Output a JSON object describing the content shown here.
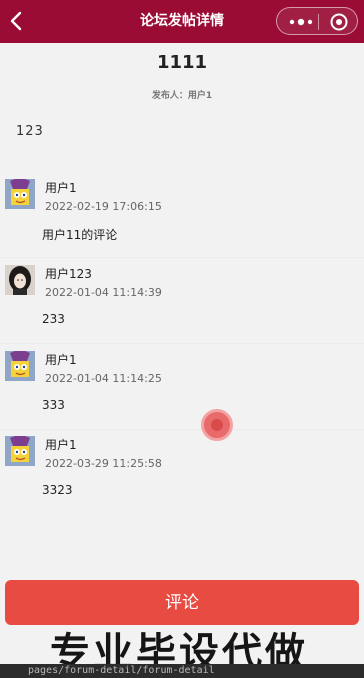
{
  "header": {
    "title": "论坛发帖详情",
    "back_icon": "chevron-left-icon",
    "more_icon": "more-dots-icon",
    "close_icon": "target-circle-icon"
  },
  "post": {
    "title": "1111",
    "author_line": "发布人：用户1",
    "content": "123"
  },
  "comments": [
    {
      "user": "用户1",
      "time": "2022-02-19 17:06:15",
      "text": "用户11的评论",
      "avatar": "sponge-avatar"
    },
    {
      "user": "用户123",
      "time": "2022-01-04 11:14:39",
      "text": "233",
      "avatar": "girl-avatar"
    },
    {
      "user": "用户1",
      "time": "2022-01-04 11:14:25",
      "text": "333",
      "avatar": "sponge-avatar"
    },
    {
      "user": "用户1",
      "time": "2022-03-29 11:25:58",
      "text": "3323",
      "avatar": "sponge-avatar"
    }
  ],
  "action": {
    "comment_label": "评论"
  },
  "watermark": "专业毕设代做",
  "path": "pages/forum-detail/forum-detail",
  "colors": {
    "navbar": "#9b0c35",
    "button": "#e84b42"
  }
}
